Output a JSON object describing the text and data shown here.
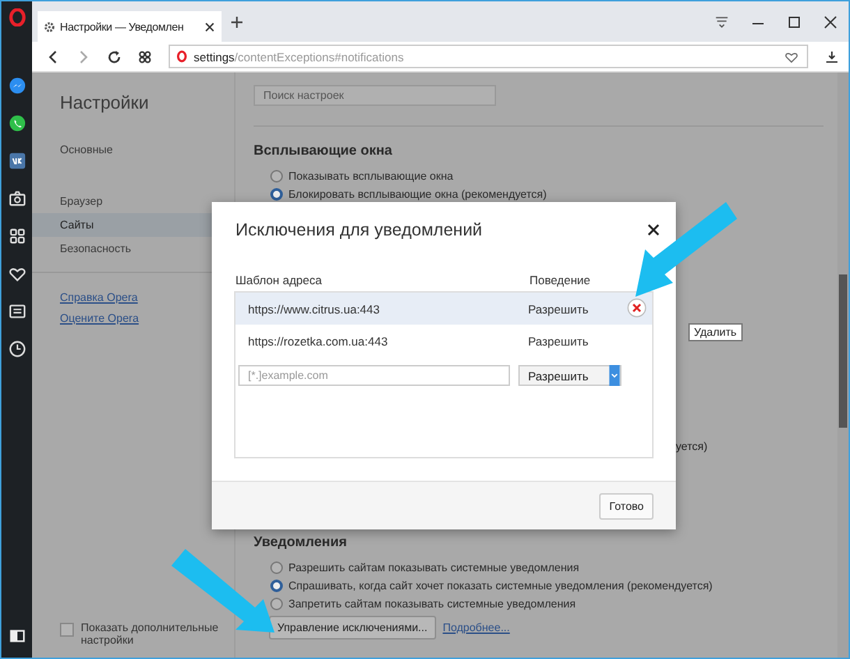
{
  "tab": {
    "title": "Настройки — Уведомлен"
  },
  "address_bar": {
    "host": "settings",
    "path": "/contentExceptions#notifications"
  },
  "settings_nav": {
    "title": "Настройки",
    "items": [
      {
        "label": "Основные",
        "selected": false
      },
      {
        "label": "Браузер",
        "selected": false
      },
      {
        "label": "Сайты",
        "selected": true
      },
      {
        "label": "Безопасность",
        "selected": false
      }
    ],
    "links": [
      "Справка Opera",
      "Оцените Opera"
    ],
    "advanced_checkbox": {
      "label": "Показать дополнительные настройки",
      "checked": false
    }
  },
  "search": {
    "placeholder": "Поиск настроек"
  },
  "popups": {
    "title": "Всплывающие окна",
    "options": [
      {
        "label": "Показывать всплывающие окна",
        "selected": false
      },
      {
        "label": "Блокировать всплывающие окна (рекомендуется)",
        "selected": true
      }
    ]
  },
  "hidden_fragment": "уется)",
  "notifications": {
    "title": "Уведомления",
    "options": [
      {
        "label": "Разрешить сайтам показывать системные уведомления",
        "selected": false
      },
      {
        "label": "Спрашивать, когда сайт хочет показать системные уведомления (рекомендуется)",
        "selected": true
      },
      {
        "label": "Запретить сайтам показывать системные уведомления",
        "selected": false
      }
    ],
    "manage_button": "Управление исключениями...",
    "link": "Подробнее..."
  },
  "dialog": {
    "title": "Исключения для уведомлений",
    "columns": [
      "Шаблон адреса",
      "Поведение"
    ],
    "rows": [
      {
        "pattern": "https://www.citrus.ua:443",
        "behavior": "Разрешить",
        "selected": true
      },
      {
        "pattern": "https://rozetka.com.ua:443",
        "behavior": "Разрешить",
        "selected": false
      }
    ],
    "new_pattern": {
      "placeholder": "[*.]example.com",
      "behavior": "Разрешить"
    },
    "done_button": "Готово"
  },
  "tooltip": "Удалить"
}
